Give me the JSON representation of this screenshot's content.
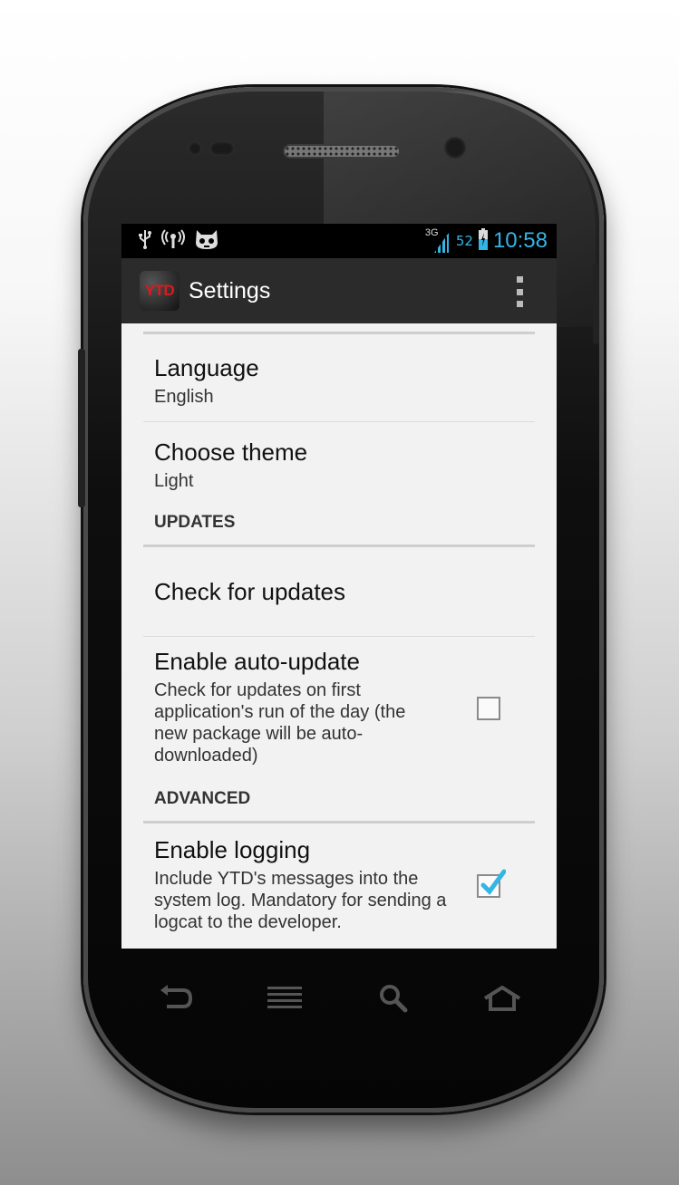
{
  "status_bar": {
    "network": "3G",
    "battery_level": "52",
    "time": "10:58",
    "icons": [
      "usb-icon",
      "wifi-hotspot-icon",
      "cyanogen-mascot-icon",
      "signal-icon",
      "battery-charging-icon"
    ]
  },
  "action_bar": {
    "logo_text": "YTD",
    "title": "Settings",
    "overflow_icon": "overflow-menu-icon"
  },
  "preferences": {
    "language": {
      "title": "Language",
      "summary": "English"
    },
    "theme": {
      "title": "Choose theme",
      "summary": "Light"
    },
    "updates_header": "UPDATES",
    "check_updates": {
      "title": "Check for updates"
    },
    "auto_update": {
      "title": "Enable auto-update",
      "summary": "Check for updates on first application's run of the day (the new package will be auto-downloaded)",
      "checked": false
    },
    "advanced_header": "ADVANCED",
    "logging": {
      "title": "Enable logging",
      "summary": "Include YTD's messages into the system log. Mandatory for sending a logcat to the developer.",
      "checked": true
    }
  },
  "nav_bar": {
    "icons": [
      "back-icon",
      "menu-icon",
      "search-icon",
      "home-icon"
    ]
  },
  "colors": {
    "accent": "#33b5e5",
    "logo_red": "#e3171b",
    "action_bar": "#2b2b2b",
    "screen_bg": "#f2f2f2"
  }
}
